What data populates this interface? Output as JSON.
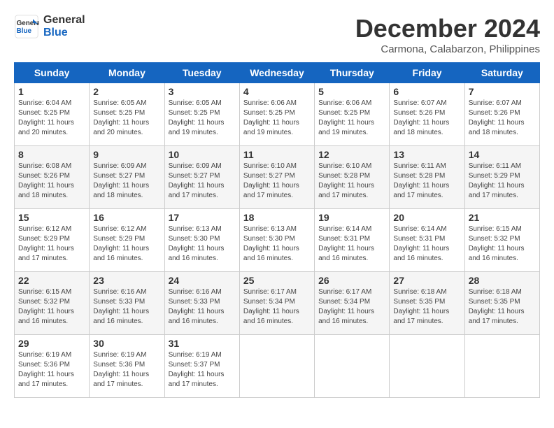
{
  "logo": {
    "line1": "General",
    "line2": "Blue"
  },
  "title": "December 2024",
  "subtitle": "Carmona, Calabarzon, Philippines",
  "days_of_week": [
    "Sunday",
    "Monday",
    "Tuesday",
    "Wednesday",
    "Thursday",
    "Friday",
    "Saturday"
  ],
  "weeks": [
    [
      {
        "day": "1",
        "info": "Sunrise: 6:04 AM\nSunset: 5:25 PM\nDaylight: 11 hours\nand 20 minutes."
      },
      {
        "day": "2",
        "info": "Sunrise: 6:05 AM\nSunset: 5:25 PM\nDaylight: 11 hours\nand 20 minutes."
      },
      {
        "day": "3",
        "info": "Sunrise: 6:05 AM\nSunset: 5:25 PM\nDaylight: 11 hours\nand 19 minutes."
      },
      {
        "day": "4",
        "info": "Sunrise: 6:06 AM\nSunset: 5:25 PM\nDaylight: 11 hours\nand 19 minutes."
      },
      {
        "day": "5",
        "info": "Sunrise: 6:06 AM\nSunset: 5:25 PM\nDaylight: 11 hours\nand 19 minutes."
      },
      {
        "day": "6",
        "info": "Sunrise: 6:07 AM\nSunset: 5:26 PM\nDaylight: 11 hours\nand 18 minutes."
      },
      {
        "day": "7",
        "info": "Sunrise: 6:07 AM\nSunset: 5:26 PM\nDaylight: 11 hours\nand 18 minutes."
      }
    ],
    [
      {
        "day": "8",
        "info": "Sunrise: 6:08 AM\nSunset: 5:26 PM\nDaylight: 11 hours\nand 18 minutes."
      },
      {
        "day": "9",
        "info": "Sunrise: 6:09 AM\nSunset: 5:27 PM\nDaylight: 11 hours\nand 18 minutes."
      },
      {
        "day": "10",
        "info": "Sunrise: 6:09 AM\nSunset: 5:27 PM\nDaylight: 11 hours\nand 17 minutes."
      },
      {
        "day": "11",
        "info": "Sunrise: 6:10 AM\nSunset: 5:27 PM\nDaylight: 11 hours\nand 17 minutes."
      },
      {
        "day": "12",
        "info": "Sunrise: 6:10 AM\nSunset: 5:28 PM\nDaylight: 11 hours\nand 17 minutes."
      },
      {
        "day": "13",
        "info": "Sunrise: 6:11 AM\nSunset: 5:28 PM\nDaylight: 11 hours\nand 17 minutes."
      },
      {
        "day": "14",
        "info": "Sunrise: 6:11 AM\nSunset: 5:29 PM\nDaylight: 11 hours\nand 17 minutes."
      }
    ],
    [
      {
        "day": "15",
        "info": "Sunrise: 6:12 AM\nSunset: 5:29 PM\nDaylight: 11 hours\nand 17 minutes."
      },
      {
        "day": "16",
        "info": "Sunrise: 6:12 AM\nSunset: 5:29 PM\nDaylight: 11 hours\nand 16 minutes."
      },
      {
        "day": "17",
        "info": "Sunrise: 6:13 AM\nSunset: 5:30 PM\nDaylight: 11 hours\nand 16 minutes."
      },
      {
        "day": "18",
        "info": "Sunrise: 6:13 AM\nSunset: 5:30 PM\nDaylight: 11 hours\nand 16 minutes."
      },
      {
        "day": "19",
        "info": "Sunrise: 6:14 AM\nSunset: 5:31 PM\nDaylight: 11 hours\nand 16 minutes."
      },
      {
        "day": "20",
        "info": "Sunrise: 6:14 AM\nSunset: 5:31 PM\nDaylight: 11 hours\nand 16 minutes."
      },
      {
        "day": "21",
        "info": "Sunrise: 6:15 AM\nSunset: 5:32 PM\nDaylight: 11 hours\nand 16 minutes."
      }
    ],
    [
      {
        "day": "22",
        "info": "Sunrise: 6:15 AM\nSunset: 5:32 PM\nDaylight: 11 hours\nand 16 minutes."
      },
      {
        "day": "23",
        "info": "Sunrise: 6:16 AM\nSunset: 5:33 PM\nDaylight: 11 hours\nand 16 minutes."
      },
      {
        "day": "24",
        "info": "Sunrise: 6:16 AM\nSunset: 5:33 PM\nDaylight: 11 hours\nand 16 minutes."
      },
      {
        "day": "25",
        "info": "Sunrise: 6:17 AM\nSunset: 5:34 PM\nDaylight: 11 hours\nand 16 minutes."
      },
      {
        "day": "26",
        "info": "Sunrise: 6:17 AM\nSunset: 5:34 PM\nDaylight: 11 hours\nand 16 minutes."
      },
      {
        "day": "27",
        "info": "Sunrise: 6:18 AM\nSunset: 5:35 PM\nDaylight: 11 hours\nand 17 minutes."
      },
      {
        "day": "28",
        "info": "Sunrise: 6:18 AM\nSunset: 5:35 PM\nDaylight: 11 hours\nand 17 minutes."
      }
    ],
    [
      {
        "day": "29",
        "info": "Sunrise: 6:19 AM\nSunset: 5:36 PM\nDaylight: 11 hours\nand 17 minutes."
      },
      {
        "day": "30",
        "info": "Sunrise: 6:19 AM\nSunset: 5:36 PM\nDaylight: 11 hours\nand 17 minutes."
      },
      {
        "day": "31",
        "info": "Sunrise: 6:19 AM\nSunset: 5:37 PM\nDaylight: 11 hours\nand 17 minutes."
      },
      {
        "day": "",
        "info": ""
      },
      {
        "day": "",
        "info": ""
      },
      {
        "day": "",
        "info": ""
      },
      {
        "day": "",
        "info": ""
      }
    ]
  ]
}
